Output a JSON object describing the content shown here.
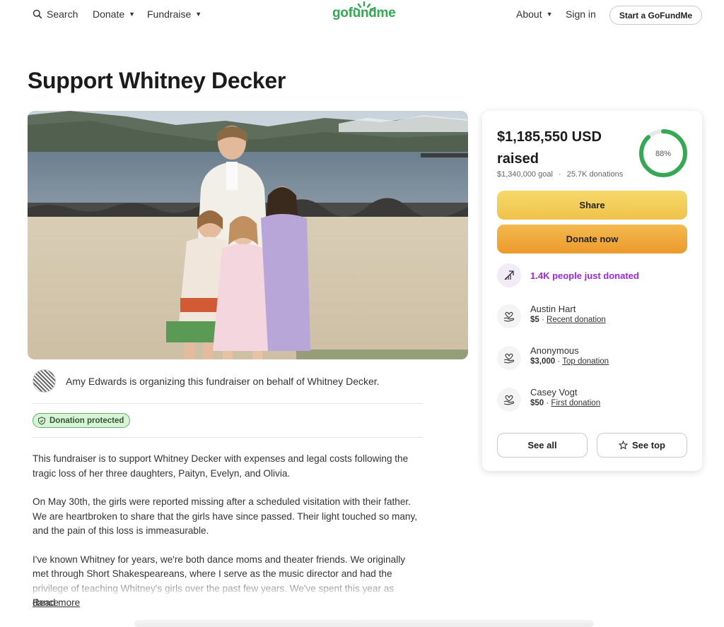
{
  "nav": {
    "search": "Search",
    "donate": "Donate",
    "fundraise": "Fundraise",
    "logo": "gofundme",
    "about": "About",
    "sign_in": "Sign in",
    "start": "Start a GoFundMe"
  },
  "page": {
    "title": "Support Whitney Decker"
  },
  "organizer": {
    "text": "Amy Edwards is organizing this fundraiser on behalf of Whitney Decker."
  },
  "badge": {
    "label": "Donation protected"
  },
  "story": {
    "paragraphs": [
      "This fundraiser is to support Whitney Decker with expenses and legal costs following the tragic loss of her three daughters, Paityn, Evelyn, and Olivia.",
      "On May 30th, the girls were reported missing after a scheduled visitation with their father. We are heartbroken to share that the girls have since passed. Their light touched so many, and the pain of this loss is immeasurable.",
      "I've known Whitney for years, we're both dance moms and theater friends. We originally met through Short Shakespeareans, where I serve as the music director and had the privilege of teaching Whitney's girls over the past few years. We've spent this year as dance"
    ],
    "read_more": "Read more"
  },
  "donation_card": {
    "raised": "$1,185,550 USD raised",
    "goal": "$1,340,000 goal",
    "sep": "·",
    "count": "25.7K donations",
    "percent_label": "88%",
    "progress": 0.88,
    "share": "Share",
    "donate_now": "Donate now",
    "trend": "1.4K people just donated",
    "donors": [
      {
        "name": "Austin Hart",
        "amount": "$5",
        "sep": " · ",
        "tag": "Recent donation"
      },
      {
        "name": "Anonymous",
        "amount": "$3,000",
        "sep": " · ",
        "tag": "Top donation"
      },
      {
        "name": "Casey Vogt",
        "amount": "$50",
        "sep": " · ",
        "tag": "First donation"
      }
    ],
    "see_all": "See all",
    "see_top": "See top"
  },
  "colors": {
    "brand_green": "#34a853",
    "accent_purple": "#9b2ad8",
    "share_yellow": "#f2cd5a",
    "donate_orange": "#f0aa3a"
  }
}
